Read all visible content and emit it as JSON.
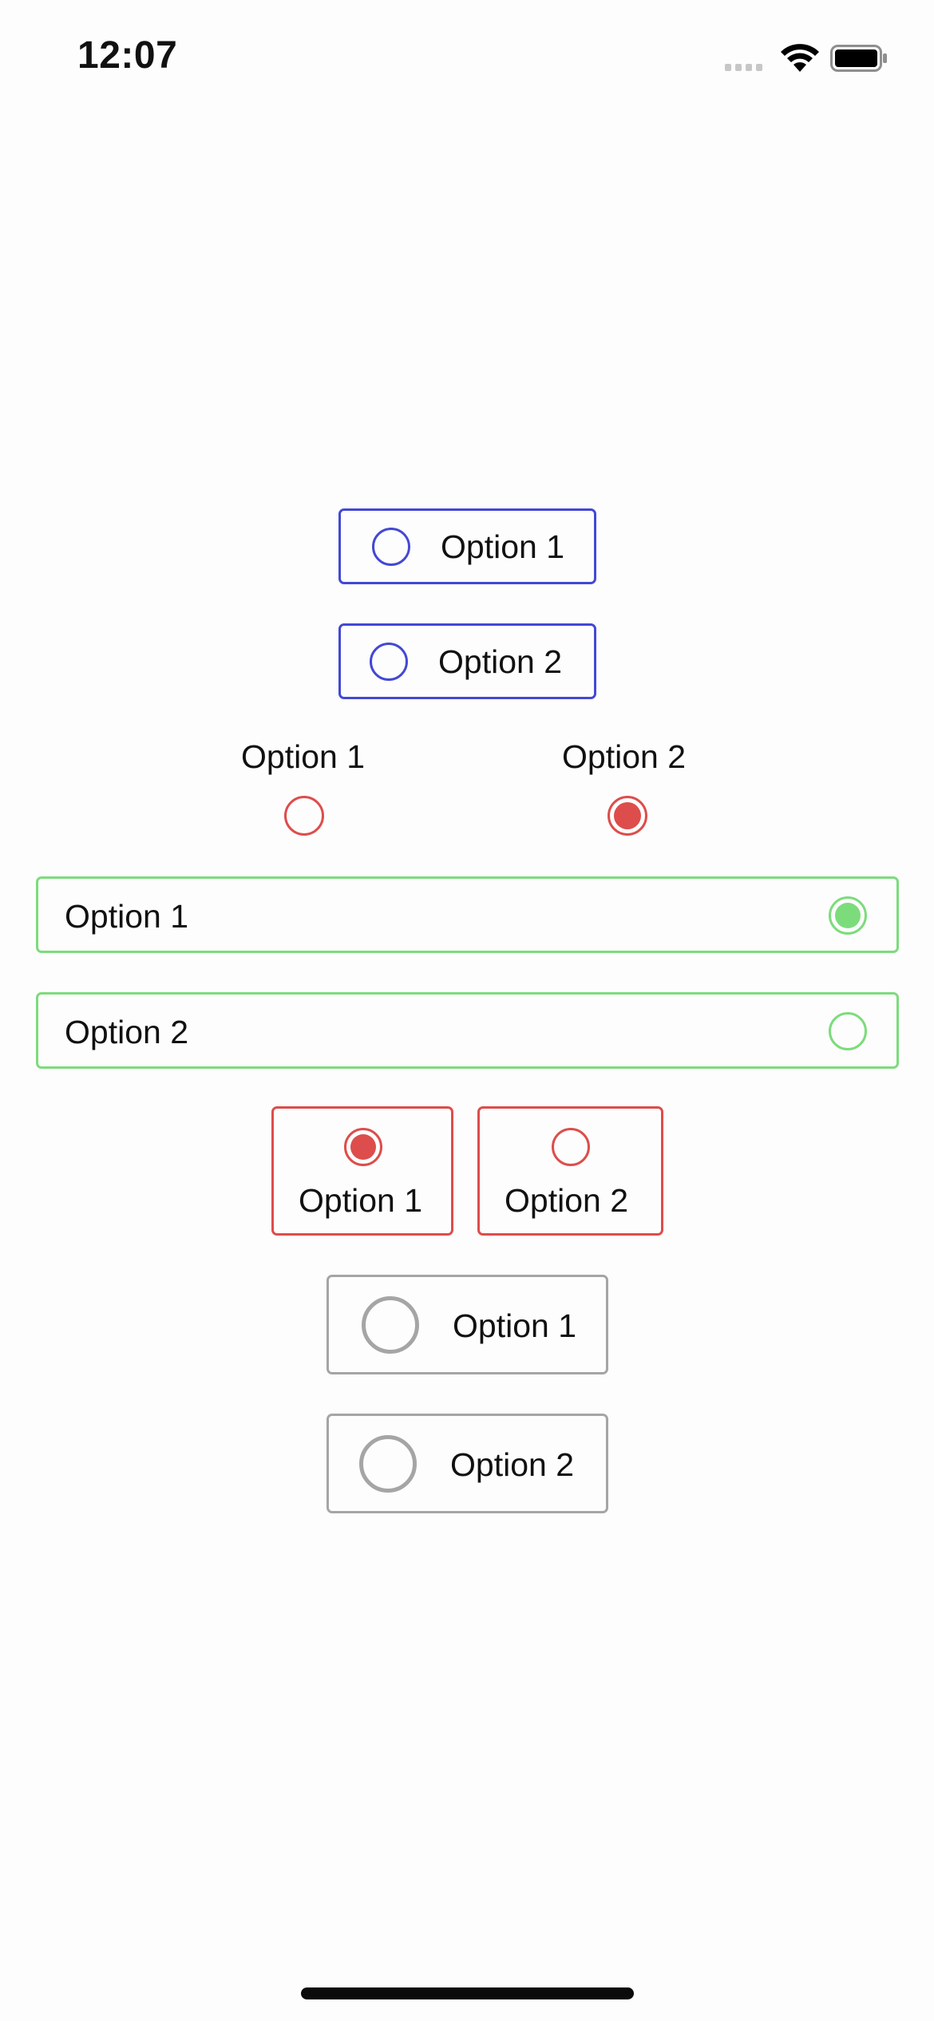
{
  "status_bar": {
    "time": "12:07",
    "icons": [
      "cellular-signal-icon",
      "wifi-icon",
      "battery-icon"
    ]
  },
  "colors": {
    "blue": "#4348d4",
    "red": "#dd4d4b",
    "green": "#7cdc7c",
    "gray": "#a5a5a5"
  },
  "groups": {
    "blue_boxes": {
      "color": "blue",
      "options": [
        {
          "label": "Option 1",
          "selected": false
        },
        {
          "label": "Option 2",
          "selected": false
        }
      ]
    },
    "red_plain": {
      "color": "red",
      "options": [
        {
          "label": "Option 1",
          "selected": false
        },
        {
          "label": "Option 2",
          "selected": true
        }
      ]
    },
    "green_rows": {
      "color": "green",
      "options": [
        {
          "label": "Option 1",
          "selected": true
        },
        {
          "label": "Option 2",
          "selected": false
        }
      ]
    },
    "red_cards": {
      "color": "red",
      "options": [
        {
          "label": "Option 1",
          "selected": true
        },
        {
          "label": "Option 2",
          "selected": false
        }
      ]
    },
    "gray_boxes": {
      "color": "gray",
      "options": [
        {
          "label": "Option 1",
          "selected": false
        },
        {
          "label": "Option 2",
          "selected": false
        }
      ]
    }
  }
}
